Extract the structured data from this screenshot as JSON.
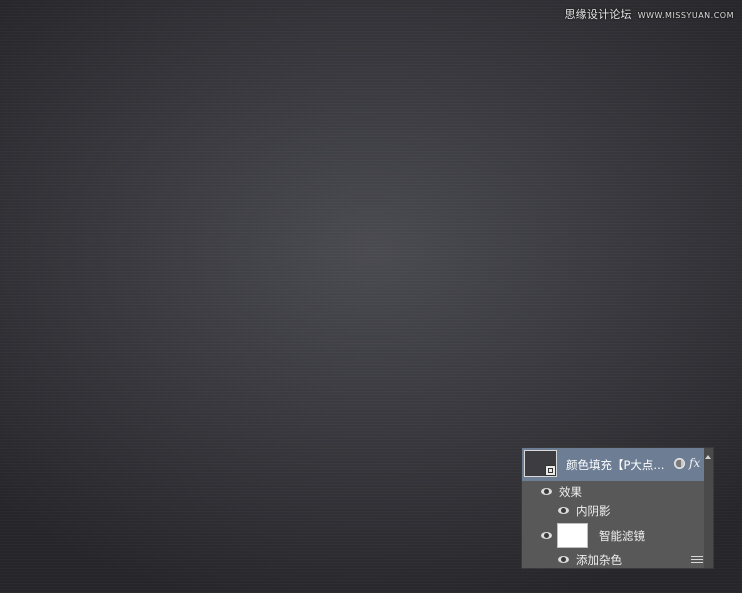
{
  "watermark": {
    "text": "思缘设计论坛",
    "site": "WWW.MISSYUAN.COM"
  },
  "layers_panel": {
    "layer": {
      "name": "颜色填充【P大点...",
      "thumbnail_color": "#3c3c41"
    },
    "effects_label": "效果",
    "inner_shadow_label": "内阴影",
    "smart_filters_label": "智能滤镜",
    "add_noise_label": "添加杂色",
    "fx_label": "fx"
  },
  "colors": {
    "selected_row": "#6c7d94",
    "panel_bg": "#585858"
  }
}
